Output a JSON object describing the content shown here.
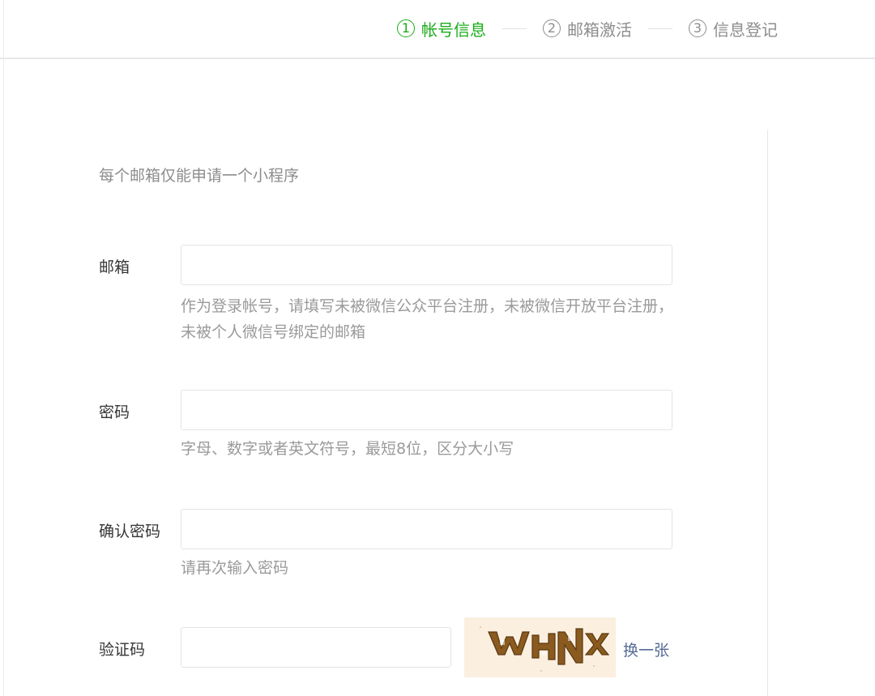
{
  "steps": [
    {
      "num": "1",
      "label": "帐号信息",
      "active": true
    },
    {
      "num": "2",
      "label": "邮箱激活",
      "active": false
    },
    {
      "num": "3",
      "label": "信息登记",
      "active": false
    }
  ],
  "form": {
    "intro": "每个邮箱仅能申请一个小程序",
    "email": {
      "label": "邮箱",
      "value": "",
      "hint": "作为登录帐号，请填写未被微信公众平台注册，未被微信开放平台注册，未被个人微信号绑定的邮箱"
    },
    "password": {
      "label": "密码",
      "value": "",
      "hint": "字母、数字或者英文符号，最短8位，区分大小写"
    },
    "confirm": {
      "label": "确认密码",
      "value": "",
      "hint": "请再次输入密码"
    },
    "captcha": {
      "label": "验证码",
      "value": "",
      "image_text": "WHNX",
      "refresh_label": "换一张"
    }
  },
  "colors": {
    "accent": "#1aad19",
    "link": "#576b95",
    "hint": "#9a9a9a"
  }
}
